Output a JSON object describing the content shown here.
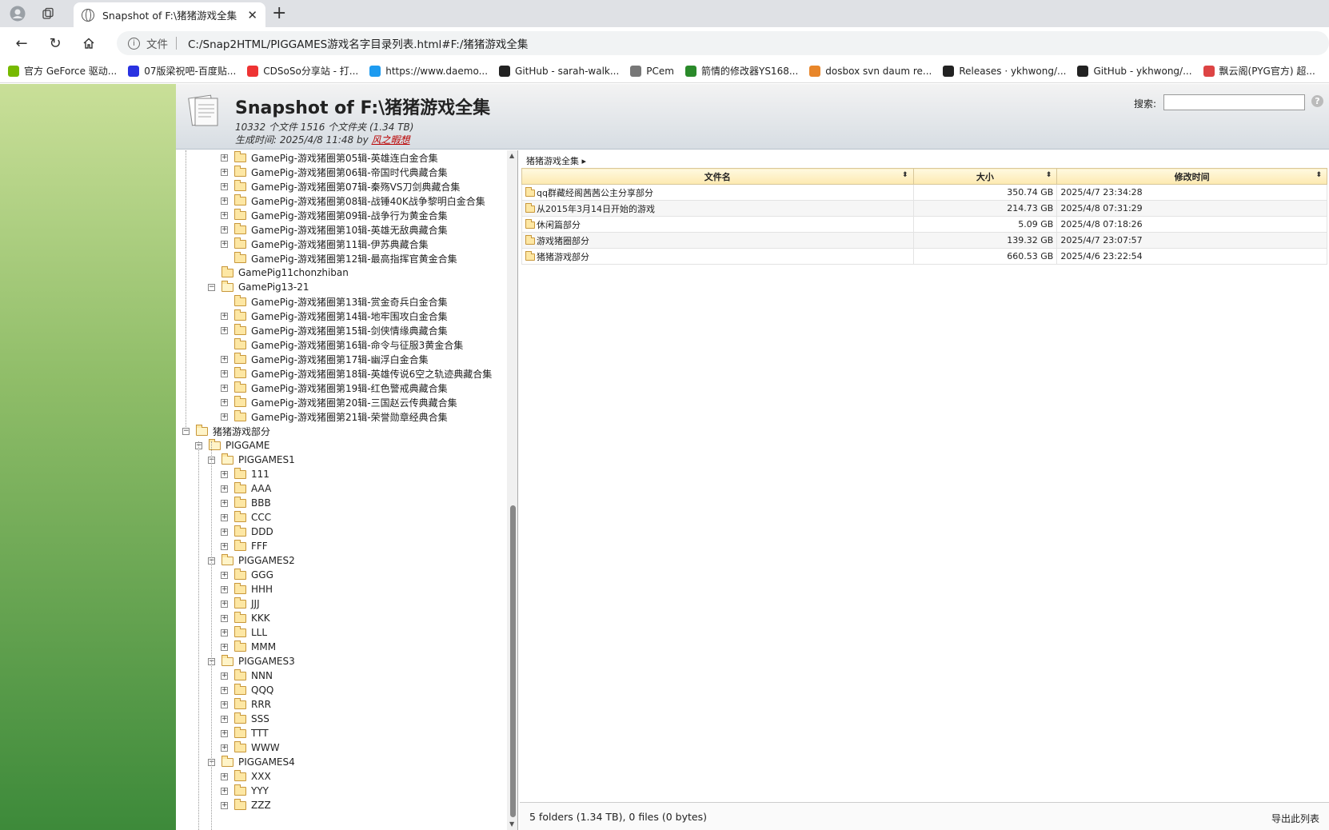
{
  "browser": {
    "tab_title": "Snapshot of F:\\猪猪游戏全集",
    "tab_close": "✕",
    "new_tab": "+",
    "url_scheme": "文件",
    "url": "C:/Snap2HTML/PIGGAMES游戏名字目录列表.html#F:/猪猪游戏全集",
    "bookmarks": [
      {
        "label": "官方 GeForce 驱动...",
        "color": "#76b900"
      },
      {
        "label": "07版梁祝吧-百度贴...",
        "color": "#2932e1"
      },
      {
        "label": "CDSoSo分享站 - 打...",
        "color": "#e33"
      },
      {
        "label": "https://www.daemo...",
        "color": "#1d9bf0"
      },
      {
        "label": "GitHub - sarah-walk...",
        "color": "#222"
      },
      {
        "label": "PCem",
        "color": "#777"
      },
      {
        "label": "箭情的修改器YS168...",
        "color": "#2a8a2a"
      },
      {
        "label": "dosbox svn daum re...",
        "color": "#e8862a"
      },
      {
        "label": "Releases · ykhwong/...",
        "color": "#222"
      },
      {
        "label": "GitHub - ykhwong/...",
        "color": "#222"
      },
      {
        "label": "飘云阁(PYG官方) 超...",
        "color": "#d44"
      }
    ]
  },
  "header": {
    "title": "Snapshot of F:\\猪猪游戏全集",
    "stats": "10332 个文件 1516 个文件夹 (1.34 TB)",
    "generated_prefix": "生成时间:   2025/4/8 11:48 by ",
    "author": "风之暇想",
    "search_label": "搜索:",
    "help": "?"
  },
  "tree": [
    {
      "label": "GamePig-游戏猪圈第05辑-英雄连白金合集",
      "level": 4,
      "toggle": "+"
    },
    {
      "label": "GamePig-游戏猪圈第06辑-帝国时代典藏合集",
      "level": 4,
      "toggle": "+"
    },
    {
      "label": "GamePig-游戏猪圈第07辑-秦殇VS刀剑典藏合集",
      "level": 4,
      "toggle": "+"
    },
    {
      "label": "GamePig-游戏猪圈第08辑-战锤40K战争黎明白金合集",
      "level": 4,
      "toggle": "+"
    },
    {
      "label": "GamePig-游戏猪圈第09辑-战争行为黄金合集",
      "level": 4,
      "toggle": "+"
    },
    {
      "label": "GamePig-游戏猪圈第10辑-英雄无敌典藏合集",
      "level": 4,
      "toggle": "+"
    },
    {
      "label": "GamePig-游戏猪圈第11辑-伊苏典藏合集",
      "level": 4,
      "toggle": "+"
    },
    {
      "label": "GamePig-游戏猪圈第12辑-最高指挥官黄金合集",
      "level": 4,
      "toggle": ""
    },
    {
      "label": "GamePig11chonzhiban",
      "level": 3,
      "toggle": ""
    },
    {
      "label": "GamePig13-21",
      "level": 3,
      "toggle": "−",
      "open": true
    },
    {
      "label": "GamePig-游戏猪圈第13辑-赏金奇兵白金合集",
      "level": 4,
      "toggle": ""
    },
    {
      "label": "GamePig-游戏猪圈第14辑-地牢围攻白金合集",
      "level": 4,
      "toggle": "+"
    },
    {
      "label": "GamePig-游戏猪圈第15辑-剑侠情缘典藏合集",
      "level": 4,
      "toggle": "+"
    },
    {
      "label": "GamePig-游戏猪圈第16辑-命令与征服3黄金合集",
      "level": 4,
      "toggle": ""
    },
    {
      "label": "GamePig-游戏猪圈第17辑-幽浮白金合集",
      "level": 4,
      "toggle": "+"
    },
    {
      "label": "GamePig-游戏猪圈第18辑-英雄传说6空之轨迹典藏合集",
      "level": 4,
      "toggle": "+"
    },
    {
      "label": "GamePig-游戏猪圈第19辑-红色警戒典藏合集",
      "level": 4,
      "toggle": "+"
    },
    {
      "label": "GamePig-游戏猪圈第20辑-三国赵云传典藏合集",
      "level": 4,
      "toggle": "+"
    },
    {
      "label": "GamePig-游戏猪圈第21辑-荣誉勋章经典合集",
      "level": 4,
      "toggle": "+"
    },
    {
      "label": "猪猪游戏部分",
      "level": 1,
      "toggle": "−",
      "open": true
    },
    {
      "label": "PIGGAME",
      "level": 2,
      "toggle": "−",
      "open": true
    },
    {
      "label": "PIGGAMES1",
      "level": 3,
      "toggle": "−",
      "open": true
    },
    {
      "label": "111",
      "level": 4,
      "toggle": "+"
    },
    {
      "label": "AAA",
      "level": 4,
      "toggle": "+"
    },
    {
      "label": "BBB",
      "level": 4,
      "toggle": "+"
    },
    {
      "label": "CCC",
      "level": 4,
      "toggle": "+"
    },
    {
      "label": "DDD",
      "level": 4,
      "toggle": "+"
    },
    {
      "label": "FFF",
      "level": 4,
      "toggle": "+"
    },
    {
      "label": "PIGGAMES2",
      "level": 3,
      "toggle": "−",
      "open": true
    },
    {
      "label": "GGG",
      "level": 4,
      "toggle": "+"
    },
    {
      "label": "HHH",
      "level": 4,
      "toggle": "+"
    },
    {
      "label": "JJJ",
      "level": 4,
      "toggle": "+"
    },
    {
      "label": "KKK",
      "level": 4,
      "toggle": "+"
    },
    {
      "label": "LLL",
      "level": 4,
      "toggle": "+"
    },
    {
      "label": "MMM",
      "level": 4,
      "toggle": "+"
    },
    {
      "label": "PIGGAMES3",
      "level": 3,
      "toggle": "−",
      "open": true
    },
    {
      "label": "NNN",
      "level": 4,
      "toggle": "+"
    },
    {
      "label": "QQQ",
      "level": 4,
      "toggle": "+"
    },
    {
      "label": "RRR",
      "level": 4,
      "toggle": "+"
    },
    {
      "label": "SSS",
      "level": 4,
      "toggle": "+"
    },
    {
      "label": "TTT",
      "level": 4,
      "toggle": "+"
    },
    {
      "label": "WWW",
      "level": 4,
      "toggle": "+"
    },
    {
      "label": "PIGGAMES4",
      "level": 3,
      "toggle": "−",
      "open": true
    },
    {
      "label": "XXX",
      "level": 4,
      "toggle": "+"
    },
    {
      "label": "YYY",
      "level": 4,
      "toggle": "+"
    },
    {
      "label": "ZZZ",
      "level": 4,
      "toggle": "+"
    }
  ],
  "files": {
    "breadcrumb": "猪猪游戏全集 ▸",
    "columns": {
      "name": "文件名",
      "size": "大小",
      "modified": "修改时间"
    },
    "sort_glyph": "⬍",
    "rows": [
      {
        "name": "qq群藏经阁茜茜公主分享部分",
        "size": "350.74 GB",
        "modified": "2025/4/7 23:34:28"
      },
      {
        "name": "从2015年3月14日开始的游戏",
        "size": "214.73 GB",
        "modified": "2025/4/8 07:31:29"
      },
      {
        "name": "休闲篇部分",
        "size": "5.09 GB",
        "modified": "2025/4/8 07:18:26"
      },
      {
        "name": "游戏猪圈部分",
        "size": "139.32 GB",
        "modified": "2025/4/7 23:07:57"
      },
      {
        "name": "猪猪游戏部分",
        "size": "660.53 GB",
        "modified": "2025/4/6 23:22:54"
      }
    ],
    "status": "5 folders (1.34 TB), 0 files (0 bytes)",
    "export": "导出此列表"
  }
}
